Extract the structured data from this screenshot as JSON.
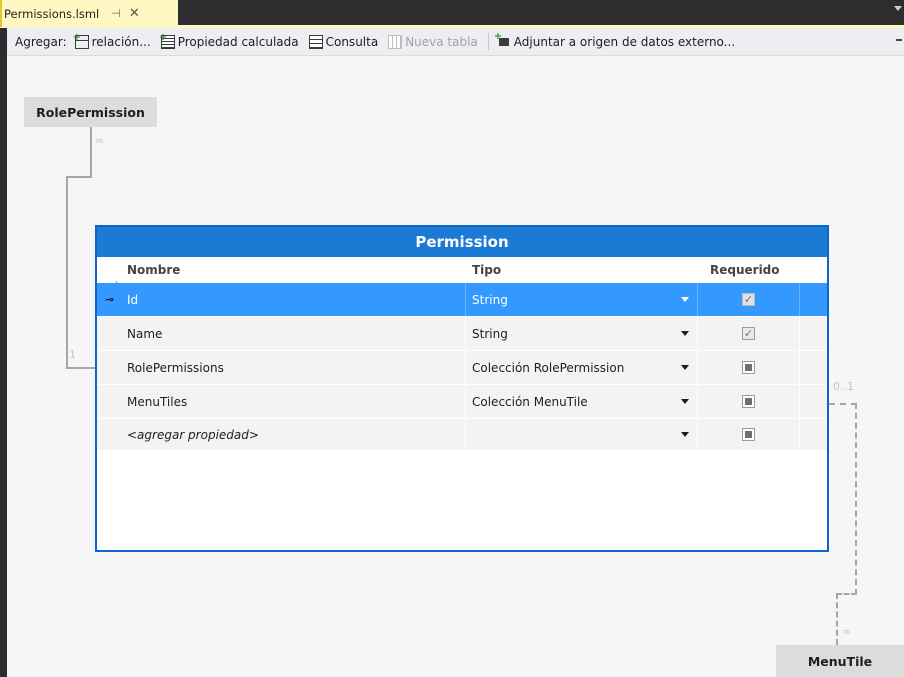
{
  "tab": {
    "title": "Permissions.lsml",
    "pin_glyph": "⊣",
    "close_glyph": "✕"
  },
  "toolbar": {
    "label": "Agregar:",
    "buttons": [
      {
        "label": "relación...",
        "icon": "relationship-icon",
        "enabled": true
      },
      {
        "label": "Propiedad calculada",
        "icon": "computed-property-icon",
        "enabled": true
      },
      {
        "label": "Consulta",
        "icon": "query-icon",
        "enabled": true
      },
      {
        "label": "Nueva tabla",
        "icon": "table-icon",
        "enabled": false
      },
      {
        "label": "Adjuntar a origen de datos externo...",
        "icon": "attach-datasource-icon",
        "enabled": true
      }
    ]
  },
  "diagram": {
    "related_entities": [
      {
        "name": "RolePermission"
      },
      {
        "name": "MenuTile"
      }
    ],
    "multiplicities": {
      "rolepermission_many": "∞",
      "permission_one": "1",
      "permission_zero_one": "0..1",
      "menutile_many": "∞"
    }
  },
  "entity": {
    "title": "Permission",
    "columns": {
      "name": "Nombre",
      "type": "Tipo",
      "required": "Requerido"
    },
    "rows": [
      {
        "name": "Id",
        "type": "String",
        "required": "checked",
        "key": true,
        "selected": true
      },
      {
        "name": "Name",
        "type": "String",
        "required": "checked",
        "key": false,
        "selected": false
      },
      {
        "name": "RolePermissions",
        "type": "Colección RolePermission",
        "required": "indeterminate",
        "key": false,
        "selected": false
      },
      {
        "name": "MenuTiles",
        "type": "Colección MenuTile",
        "required": "indeterminate",
        "key": false,
        "selected": false
      },
      {
        "name": "<agregar propiedad>",
        "type": "",
        "required": "indeterminate",
        "key": false,
        "selected": false,
        "placeholder": true
      }
    ]
  },
  "colors": {
    "entity_header": "#1a7ad4",
    "selection": "#3399ff",
    "tab_active": "#fff8c2",
    "chrome_dark": "#2d2d30"
  }
}
